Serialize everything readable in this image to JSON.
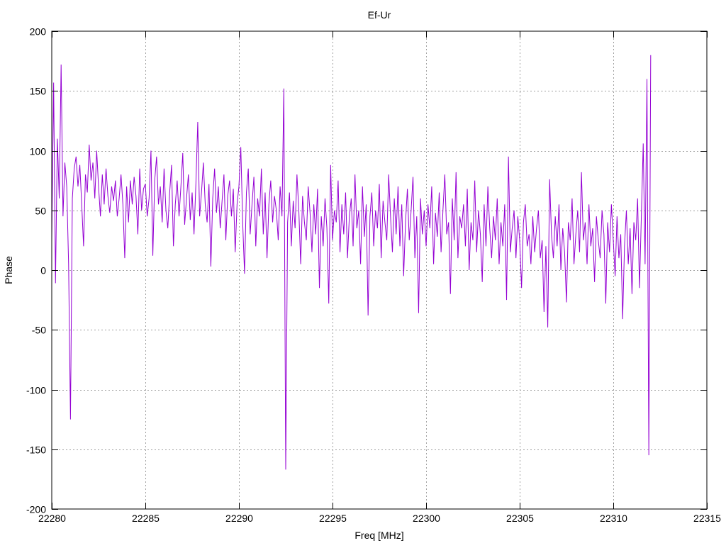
{
  "chart_data": {
    "type": "line",
    "title": "Ef-Ur",
    "xlabel": "Freq [MHz]",
    "ylabel": "Phase",
    "xlim": [
      22280,
      22315
    ],
    "ylim": [
      -200,
      200
    ],
    "xticks": [
      22280,
      22285,
      22290,
      22295,
      22300,
      22305,
      22310,
      22315
    ],
    "yticks": [
      -200,
      -150,
      -100,
      -50,
      0,
      50,
      100,
      150,
      200
    ],
    "grid": true,
    "legend": "none",
    "series": [
      {
        "name": "Ef-Ur",
        "color": "#9400d3",
        "x_start": 22280,
        "x_step": 0.1,
        "values": [
          24,
          157,
          -11,
          110,
          60,
          172,
          45,
          90,
          70,
          5,
          -125,
          60,
          85,
          95,
          70,
          88,
          55,
          20,
          80,
          65,
          105,
          75,
          90,
          60,
          100,
          70,
          45,
          80,
          55,
          85,
          62,
          48,
          70,
          58,
          75,
          45,
          60,
          80,
          55,
          10,
          70,
          40,
          75,
          55,
          78,
          62,
          30,
          85,
          50,
          68,
          72,
          45,
          60,
          100,
          12,
          75,
          95,
          55,
          70,
          40,
          85,
          50,
          35,
          65,
          88,
          20,
          55,
          75,
          45,
          70,
          98,
          38,
          60,
          80,
          42,
          65,
          30,
          72,
          124,
          45,
          65,
          90,
          55,
          40,
          72,
          3,
          60,
          85,
          48,
          70,
          35,
          58,
          80,
          25,
          62,
          75,
          45,
          68,
          15,
          55,
          70,
          103,
          40,
          -3,
          65,
          85,
          30,
          55,
          78,
          20,
          60,
          45,
          85,
          30,
          65,
          10,
          55,
          75,
          40,
          62,
          50,
          25,
          70,
          45,
          152,
          -167,
          40,
          65,
          20,
          58,
          35,
          80,
          50,
          5,
          62,
          40,
          25,
          70,
          48,
          15,
          55,
          30,
          68,
          -15,
          45,
          20,
          60,
          35,
          -28,
          88,
          25,
          50,
          40,
          75,
          15,
          55,
          30,
          65,
          10,
          45,
          60,
          20,
          80,
          35,
          50,
          5,
          70,
          28,
          55,
          -38,
          45,
          65,
          20,
          50,
          35,
          72,
          10,
          58,
          40,
          25,
          80,
          45,
          15,
          60,
          30,
          70,
          20,
          55,
          -5,
          40,
          68,
          25,
          50,
          78,
          10,
          45,
          -36,
          60,
          30,
          50,
          20,
          55,
          35,
          70,
          5,
          48,
          28,
          65,
          15,
          50,
          80,
          30,
          40,
          -20,
          60,
          25,
          82,
          10,
          45,
          35,
          55,
          20,
          68,
          0,
          40,
          25,
          75,
          15,
          50,
          30,
          -10,
          55,
          20,
          70,
          35,
          10,
          45,
          25,
          60,
          5,
          40,
          20,
          55,
          -25,
          95,
          15,
          35,
          50,
          10,
          45,
          25,
          -15,
          40,
          55,
          20,
          30,
          5,
          45,
          15,
          35,
          50,
          10,
          25,
          -35,
          20,
          -48,
          76,
          30,
          10,
          45,
          20,
          55,
          0,
          35,
          15,
          -27,
          40,
          25,
          60,
          5,
          30,
          50,
          15,
          82,
          25,
          40,
          5,
          55,
          20,
          35,
          -10,
          45,
          25,
          10,
          50,
          30,
          -28,
          40,
          15,
          55,
          25,
          -5,
          45,
          10,
          30,
          -41,
          20,
          50,
          5,
          35,
          -20,
          40,
          25,
          60,
          -15,
          45,
          106,
          5,
          160,
          -155,
          180
        ]
      }
    ]
  }
}
